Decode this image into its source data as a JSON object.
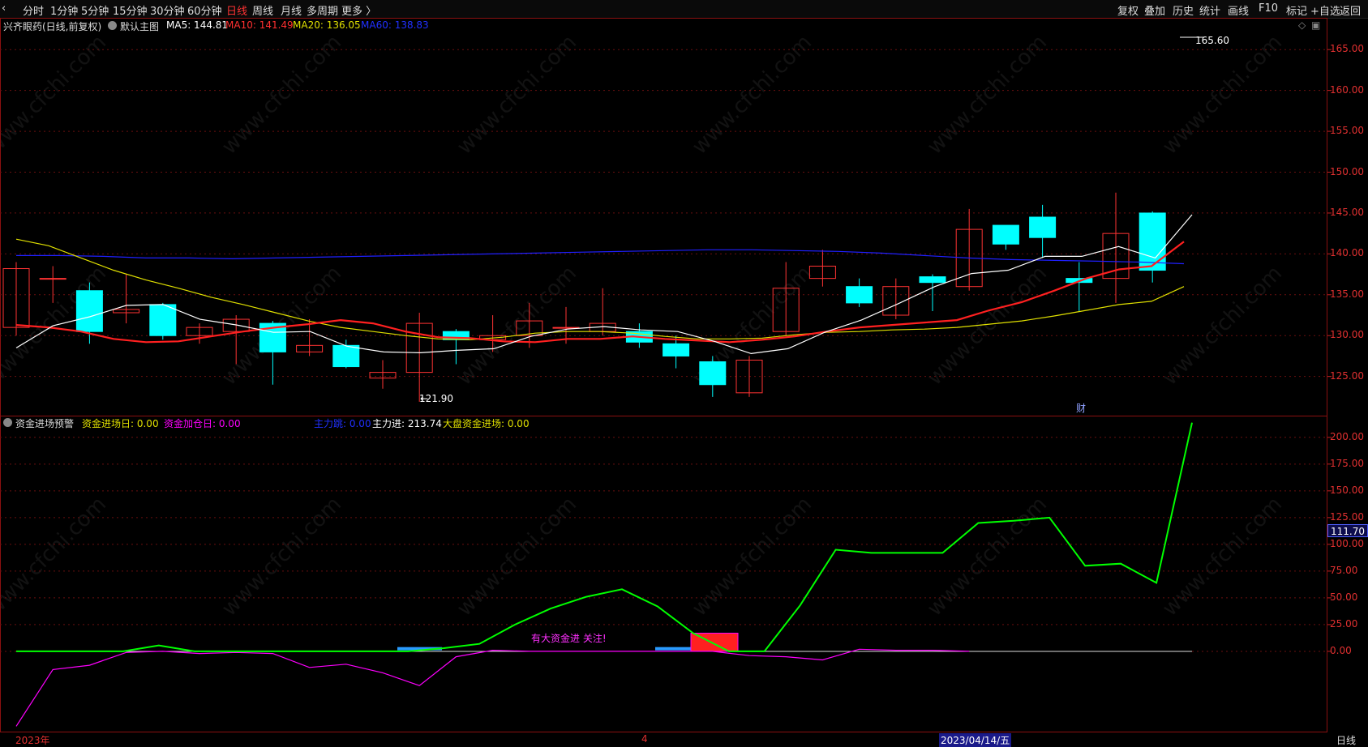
{
  "toolbar": {
    "left": [
      "分时",
      "1分钟",
      "5分钟",
      "15分钟",
      "30分钟",
      "60分钟",
      "日线",
      "周线",
      "月线",
      "多周期",
      "更多 〉"
    ],
    "right": [
      "复权",
      "叠加",
      "历史",
      "统计",
      "画线",
      "F10",
      "标记",
      "+自选",
      "返回"
    ]
  },
  "main_header": {
    "title": "兴齐眼药(日线,前复权)",
    "template": "默认主图",
    "ma5": "MA5: 144.81",
    "ma10": "MA10: 141.49",
    "ma20": "MA20: 136.05",
    "ma60": "MA60: 138.83"
  },
  "sub_header": {
    "name": "资金进场预警",
    "f1": "资金进场日: 0.00",
    "f2": "资金加仓日: 0.00",
    "f3": "主力跳: 0.00",
    "f4": "主力进: 213.74",
    "f5": "大盘资金进场: 0.00"
  },
  "annotations": {
    "high": "165.60",
    "low": "121.90",
    "cai": "财",
    "signal": "有大资金进 关注!"
  },
  "price_marker": "111.70",
  "bottom_bar": {
    "year": "2023年",
    "month": "4",
    "date": "2023/04/14/五",
    "period": "日线"
  },
  "watermark": "www.cfchi.com",
  "colors": {
    "up": "#ff3333",
    "down": "#00ffff",
    "ma5": "#ffffff",
    "ma10": "#ff2020",
    "ma20": "#e0e000",
    "ma60": "#2020ff",
    "main_in": "#00ff00",
    "magenta": "#ff00ff"
  },
  "chart_data": [
    {
      "type": "candlestick",
      "y_ticks": [
        "165.00",
        "160.00",
        "155.00",
        "150.00",
        "145.00",
        "140.00",
        "135.00",
        "130.00",
        "125.00"
      ],
      "ylim": [
        121.0,
        167.5
      ],
      "candles": [
        {
          "o": 131.0,
          "h": 139.0,
          "l": 130.0,
          "c": 138.2
        },
        {
          "o": 137.0,
          "h": 138.5,
          "l": 134.0,
          "c": 137.0
        },
        {
          "o": 135.5,
          "h": 136.5,
          "l": 129.0,
          "c": 130.5
        },
        {
          "o": 132.8,
          "h": 137.5,
          "l": 131.5,
          "c": 133.2
        },
        {
          "o": 133.8,
          "h": 134.0,
          "l": 129.5,
          "c": 130.0
        },
        {
          "o": 130.0,
          "h": 131.5,
          "l": 129.0,
          "c": 131.0
        },
        {
          "o": 130.5,
          "h": 132.5,
          "l": 126.5,
          "c": 132.0
        },
        {
          "o": 131.5,
          "h": 131.8,
          "l": 124.0,
          "c": 128.0
        },
        {
          "o": 128.0,
          "h": 132.0,
          "l": 127.5,
          "c": 128.8
        },
        {
          "o": 128.8,
          "h": 129.5,
          "l": 126.0,
          "c": 126.2
        },
        {
          "o": 124.8,
          "h": 127.0,
          "l": 123.5,
          "c": 125.5
        },
        {
          "o": 125.5,
          "h": 132.8,
          "l": 121.9,
          "c": 131.5
        },
        {
          "o": 130.5,
          "h": 130.8,
          "l": 126.5,
          "c": 129.5
        },
        {
          "o": 129.5,
          "h": 132.5,
          "l": 128.0,
          "c": 130.0
        },
        {
          "o": 130.0,
          "h": 134.0,
          "l": 128.5,
          "c": 131.8
        },
        {
          "o": 131.0,
          "h": 133.5,
          "l": 129.0,
          "c": 131.0
        },
        {
          "o": 130.5,
          "h": 135.8,
          "l": 130.0,
          "c": 131.5
        },
        {
          "o": 130.5,
          "h": 131.5,
          "l": 128.5,
          "c": 129.2
        },
        {
          "o": 129.0,
          "h": 130.0,
          "l": 126.0,
          "c": 127.5
        },
        {
          "o": 126.8,
          "h": 127.5,
          "l": 122.5,
          "c": 124.0
        },
        {
          "o": 123.0,
          "h": 127.5,
          "l": 122.5,
          "c": 127.0
        },
        {
          "o": 130.5,
          "h": 139.0,
          "l": 130.0,
          "c": 135.8
        },
        {
          "o": 137.0,
          "h": 140.5,
          "l": 136.0,
          "c": 138.5
        },
        {
          "o": 136.0,
          "h": 137.0,
          "l": 133.5,
          "c": 134.0
        },
        {
          "o": 132.5,
          "h": 137.0,
          "l": 132.0,
          "c": 136.0
        },
        {
          "o": 137.2,
          "h": 137.5,
          "l": 133.0,
          "c": 136.5
        },
        {
          "o": 136.0,
          "h": 145.5,
          "l": 135.5,
          "c": 143.0
        },
        {
          "o": 143.5,
          "h": 143.5,
          "l": 140.5,
          "c": 141.2
        },
        {
          "o": 144.5,
          "h": 146.0,
          "l": 139.5,
          "c": 142.0
        },
        {
          "o": 137.0,
          "h": 139.0,
          "l": 133.0,
          "c": 136.5
        },
        {
          "o": 137.0,
          "h": 147.5,
          "l": 134.0,
          "c": 142.5
        },
        {
          "o": 145.0,
          "h": 145.2,
          "l": 136.5,
          "c": 138.0
        }
      ],
      "ma5": [
        128.5,
        131.2,
        132.3,
        133.7,
        133.8,
        132.0,
        131.3,
        130.4,
        130.5,
        128.7,
        128.0,
        127.9,
        128.2,
        128.4,
        129.9,
        130.8,
        131.1,
        130.7,
        130.5,
        129.3,
        127.8,
        128.4,
        130.4,
        131.9,
        133.9,
        136.0,
        137.6,
        138.0,
        139.7,
        139.7,
        140.9,
        139.5,
        144.8
      ],
      "ma10": [
        131.3,
        131.0,
        130.5,
        129.6,
        129.2,
        129.3,
        129.9,
        130.5,
        131.0,
        131.4,
        131.9,
        131.5,
        130.5,
        129.8,
        129.7,
        129.3,
        129.2,
        129.6,
        129.6,
        129.9,
        129.6,
        129.4,
        129.2,
        129.5,
        129.9,
        130.5,
        131.0,
        131.3,
        131.6,
        131.9,
        133.1,
        134.1,
        135.5,
        137.0,
        138.1,
        138.5,
        141.5
      ],
      "ma20": [
        141.8,
        141.0,
        139.5,
        138.0,
        136.8,
        135.8,
        134.7,
        133.8,
        132.8,
        131.8,
        131.0,
        130.5,
        130.0,
        129.6,
        129.5,
        129.8,
        130.3,
        130.5,
        130.5,
        130.3,
        129.9,
        129.6,
        129.6,
        129.7,
        130.1,
        130.4,
        130.5,
        130.7,
        130.8,
        131.0,
        131.4,
        131.8,
        132.4,
        133.1,
        133.8,
        134.2,
        136.0
      ],
      "ma60": [
        139.8,
        139.8,
        139.7,
        139.5,
        139.5,
        139.4,
        139.5,
        139.6,
        139.7,
        139.8,
        139.9,
        140.0,
        140.1,
        140.2,
        140.3,
        140.4,
        140.5,
        140.5,
        140.4,
        140.3,
        140.1,
        139.8,
        139.5,
        139.3,
        139.2,
        139.1,
        139.0,
        138.8
      ]
    },
    {
      "type": "line",
      "y_ticks": [
        "200.00",
        "175.00",
        "150.00",
        "125.00",
        "100.00",
        "75.00",
        "50.00",
        "25.00",
        "0.00"
      ],
      "ylim": [
        -75,
        215
      ],
      "series": [
        {
          "name": "主力进",
          "values": [
            0,
            0,
            0,
            0,
            5.5,
            0,
            0,
            0,
            0,
            0,
            0,
            0,
            3,
            7,
            25,
            40,
            51,
            58,
            42,
            17,
            0,
            0,
            43,
            95,
            92,
            92,
            92,
            120,
            122,
            125,
            80,
            82,
            64,
            213.74
          ]
        },
        {
          "name": "主力跳",
          "values": [
            -70,
            -17,
            -13,
            -1,
            0,
            -2,
            -1,
            -2,
            -15,
            -12,
            -20,
            -32,
            -5,
            1,
            0,
            0,
            0,
            0,
            0,
            0,
            -4,
            -5,
            -8,
            2,
            1,
            1,
            0
          ]
        }
      ]
    }
  ]
}
